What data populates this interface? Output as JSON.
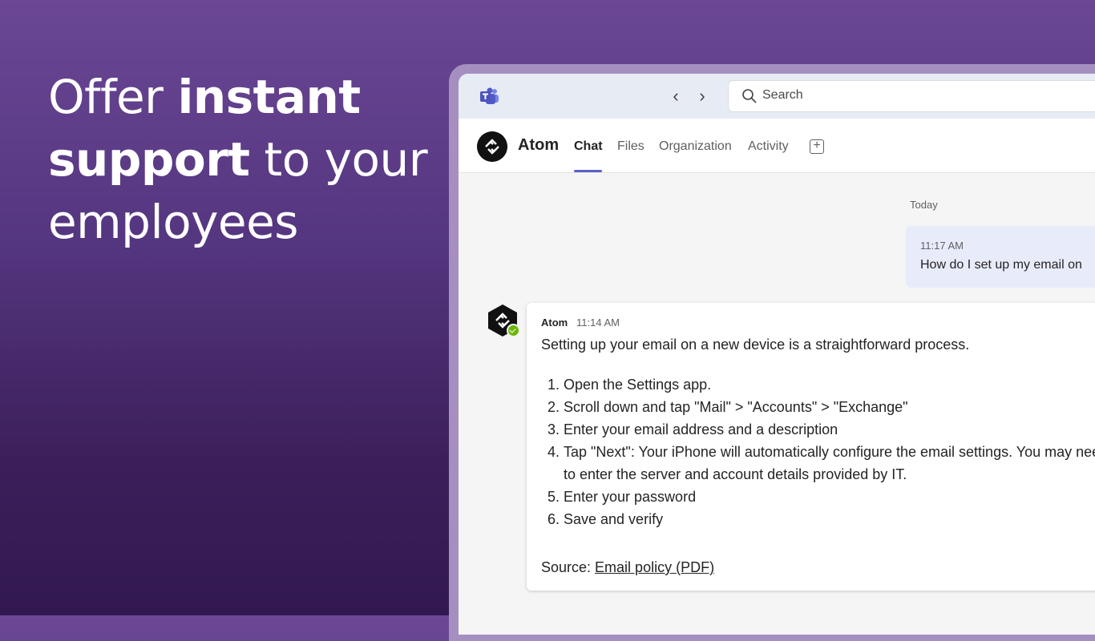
{
  "headline": {
    "line1_light": "Offer ",
    "line1_bold": "instant",
    "line2_bold": "support",
    "line2_light": " to your",
    "line3_light": "employees"
  },
  "titlebar": {
    "back_glyph": "‹",
    "forward_glyph": "›",
    "search_placeholder": "Search",
    "icons": [
      "teams-logo-icon",
      "chevron-left-icon",
      "chevron-right-icon",
      "search-icon"
    ]
  },
  "app": {
    "name": "Atom",
    "tabs": [
      {
        "label": "Chat",
        "active": true
      },
      {
        "label": "Files",
        "active": false
      },
      {
        "label": "Organization",
        "active": false
      },
      {
        "label": "Activity",
        "active": false
      }
    ],
    "add_tab_glyph": "+"
  },
  "chat": {
    "date_divider": "Today",
    "sent": {
      "time": "11:17 AM",
      "text": "How do I set up my email on"
    },
    "reply": {
      "sender": "Atom",
      "time": "11:14 AM",
      "intro": "Setting up your email on a new device is a straightforward process.",
      "steps": [
        "Open the Settings app.",
        "Scroll down and tap \"Mail\" > \"Accounts\" > \"Exchange\"",
        "Enter your email address and a description",
        "Tap \"Next\": Your iPhone will automatically configure the email settings. You may need to enter the server and account details provided by IT.",
        "Enter your password",
        "Save and verify"
      ],
      "source_label": "Source: ",
      "source_link": "Email policy (PDF)"
    }
  },
  "colors": {
    "background_top": "#6b4795",
    "background_bottom": "#321850",
    "accent": "#5b5fc7",
    "sent_bubble": "#e8ebfa",
    "presence_available": "#6bb700"
  }
}
